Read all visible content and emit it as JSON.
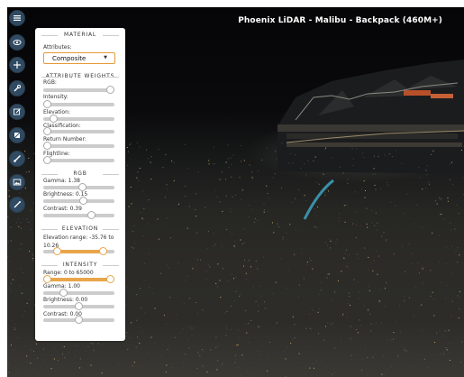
{
  "viewer": {
    "title": "Phoenix LiDAR - Malibu - Backpack (460M+)"
  },
  "toolbar": {
    "tools": [
      {
        "icon": "menu-icon"
      },
      {
        "icon": "eye-icon"
      },
      {
        "icon": "move-icon"
      },
      {
        "icon": "wrench-icon"
      },
      {
        "icon": "edit-icon"
      },
      {
        "icon": "cube-icon"
      },
      {
        "icon": "brush-icon"
      },
      {
        "icon": "image-icon"
      },
      {
        "icon": "measure-icon"
      }
    ]
  },
  "panel": {
    "material_heading": "MATERIAL",
    "attributes_label": "Attributes:",
    "attributes_value": "Composite",
    "weights_heading": "ATTRIBUTE WEIGHTS",
    "weights": [
      {
        "label": "RGB:",
        "value": 1.0
      },
      {
        "label": "Intensity:",
        "value": 0.0
      },
      {
        "label": "Elevation:",
        "value": 0.1
      },
      {
        "label": "Classification:",
        "value": 0.0
      },
      {
        "label": "Return Number:",
        "value": 0.0
      },
      {
        "label": "Flightline:",
        "value": 0.0
      }
    ],
    "rgb_heading": "RGB",
    "rgb": {
      "gamma_label": "Gamma: 1.38",
      "gamma": 0.55,
      "brightness_label": "Brightness: 0.15",
      "brightness": 0.57,
      "contrast_label": "Contrast: 0.39",
      "contrast": 0.7
    },
    "elevation_heading": "ELEVATION",
    "elevation": {
      "range_label": "Elevation range: -35.76 to 10.26",
      "low": 0.15,
      "high": 0.88
    },
    "intensity_heading": "INTENSITY",
    "intensity": {
      "range_label": "Range: 0 to 65000",
      "low": 0.0,
      "high": 1.0,
      "gamma_label": "Gamma: 1.00",
      "gamma": 0.25,
      "brightness_label": "Brightness: 0.00",
      "brightness": 0.5,
      "contrast_label": "Contrast: 0.00",
      "contrast": 0.5
    }
  },
  "colors": {
    "accent": "#e9a54b",
    "tool_bg": "#2f4a62",
    "points": "#c9a36a"
  }
}
